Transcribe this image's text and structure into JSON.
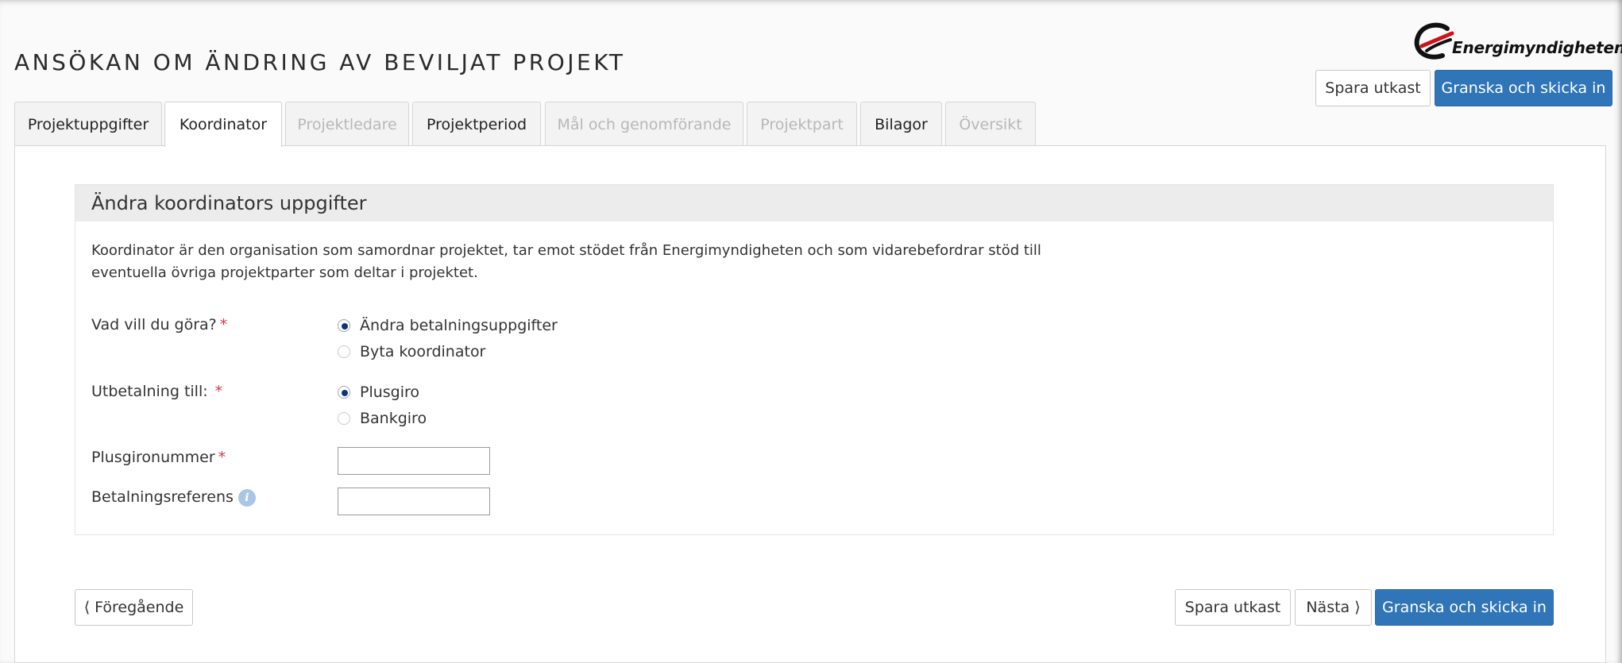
{
  "page": {
    "title": "ANSÖKAN OM ÄNDRING AV BEVILJAT PROJEKT",
    "logo_text": "Energimyndigheten"
  },
  "header_actions": {
    "save_draft": "Spara utkast",
    "review_submit": "Granska och skicka in"
  },
  "tabs": [
    {
      "label": "Projektuppgifter",
      "state": "enabled"
    },
    {
      "label": "Koordinator",
      "state": "active"
    },
    {
      "label": "Projektledare",
      "state": "disabled"
    },
    {
      "label": "Projektperiod",
      "state": "enabled"
    },
    {
      "label": "Mål och genomförande",
      "state": "disabled"
    },
    {
      "label": "Projektpart",
      "state": "disabled"
    },
    {
      "label": "Bilagor",
      "state": "enabled"
    },
    {
      "label": "Översikt",
      "state": "disabled"
    }
  ],
  "panel": {
    "heading": "Ändra koordinators uppgifter",
    "description_line1": "Koordinator är den organisation som samordnar projektet, tar emot stödet från Energimyndigheten och som vidarebefordrar stöd till",
    "description_line2": "eventuella övriga projektparter som deltar i projektet."
  },
  "form": {
    "action_label": "Vad vill du göra?",
    "action_options": [
      {
        "label": "Ändra betalningsuppgifter",
        "checked": true
      },
      {
        "label": "Byta koordinator",
        "checked": false
      }
    ],
    "payout_label": "Utbetalning till:",
    "payout_options": [
      {
        "label": "Plusgiro",
        "checked": true
      },
      {
        "label": "Bankgiro",
        "checked": false
      }
    ],
    "plusgiro_label": "Plusgironummer",
    "plusgiro_value": "",
    "reference_label": "Betalningsreferens",
    "reference_value": "",
    "required_mark": "*",
    "info_glyph": "i"
  },
  "footer": {
    "previous": "⟨ Föregående",
    "save_draft": "Spara utkast",
    "next": "Nästa ⟩",
    "review_submit": "Granska och skicka in"
  },
  "colors": {
    "primary": "#2f75b8",
    "radio_dot": "#12337a",
    "required": "#d23a4f"
  }
}
